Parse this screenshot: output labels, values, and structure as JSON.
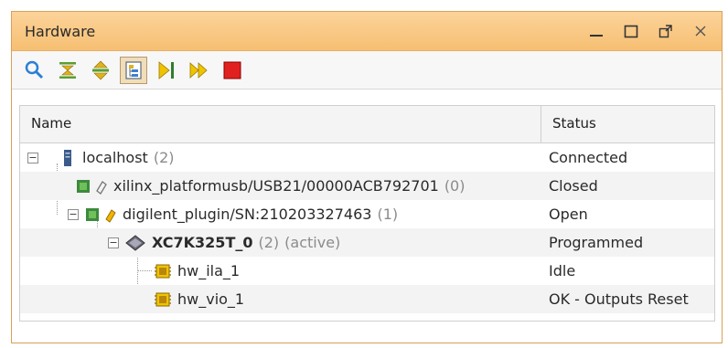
{
  "window": {
    "title": "Hardware"
  },
  "toolbar": {
    "buttons": [
      {
        "icon": "search-icon"
      },
      {
        "icon": "collapse-all-icon"
      },
      {
        "icon": "expand-all-icon"
      },
      {
        "icon": "hierarchy-icon",
        "pressed": true
      },
      {
        "icon": "run-trigger-icon"
      },
      {
        "icon": "run-trigger-immediate-icon"
      },
      {
        "icon": "stop-icon"
      }
    ]
  },
  "table": {
    "columns": {
      "name": "Name",
      "status": "Status"
    },
    "rows": [
      {
        "label": "localhost",
        "count": "(2)",
        "extra": "",
        "status": "Connected",
        "icon": "server-icon",
        "bold": false
      },
      {
        "label": "xilinx_platformusb/USB21/00000ACB792701",
        "count": "(0)",
        "extra": "",
        "status": "Closed",
        "icon": "jtag-cable-icon",
        "bold": false
      },
      {
        "label": "digilent_plugin/SN:210203327463",
        "count": "(1)",
        "extra": "",
        "status": "Open",
        "icon": "jtag-cable-icon",
        "bold": false
      },
      {
        "label": "XC7K325T_0",
        "count": "(2)",
        "extra": "(active)",
        "status": "Programmed",
        "icon": "fpga-device-icon",
        "bold": true
      },
      {
        "label": "hw_ila_1",
        "count": "",
        "extra": "",
        "status": "Idle",
        "icon": "debug-core-icon",
        "bold": false
      },
      {
        "label": "hw_vio_1",
        "count": "",
        "extra": "",
        "status": "OK - Outputs Reset",
        "icon": "debug-core-icon",
        "bold": false
      }
    ]
  }
}
